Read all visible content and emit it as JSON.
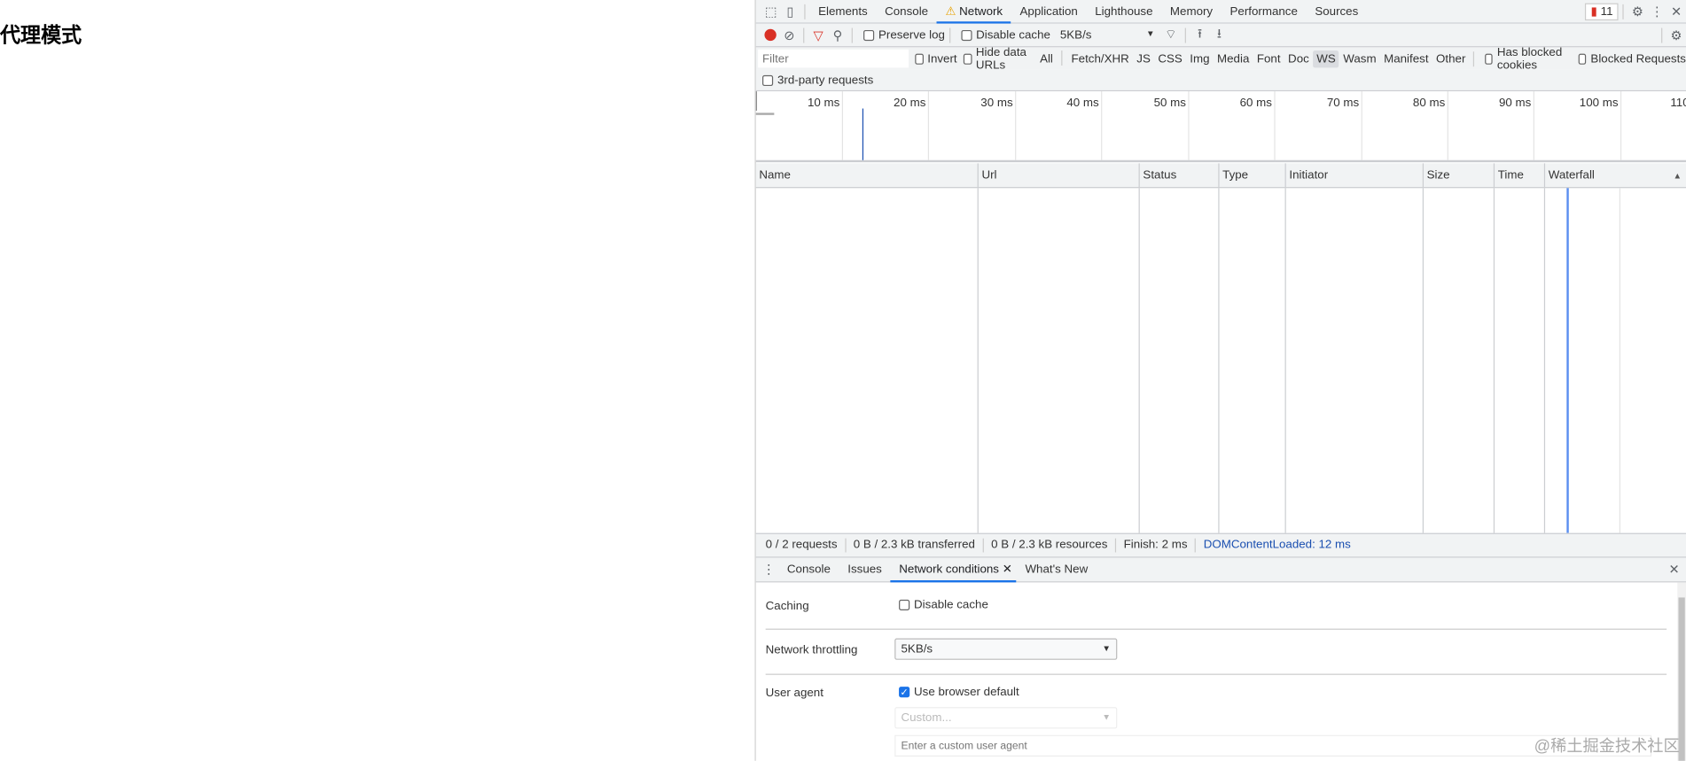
{
  "page": {
    "title": "代理模式"
  },
  "devtools": {
    "tabs": [
      "Elements",
      "Console",
      "Network",
      "Application",
      "Lighthouse",
      "Memory",
      "Performance",
      "Sources"
    ],
    "active_tab": "Network",
    "issues_count": "11",
    "toolbar": {
      "preserve_log": "Preserve log",
      "disable_cache": "Disable cache",
      "throttle": "5KB/s"
    },
    "filter": {
      "placeholder": "Filter",
      "invert": "Invert",
      "hide_data_urls": "Hide data URLs",
      "types": [
        "All",
        "Fetch/XHR",
        "JS",
        "CSS",
        "Img",
        "Media",
        "Font",
        "Doc",
        "WS",
        "Wasm",
        "Manifest",
        "Other"
      ],
      "selected_type": "WS",
      "has_blocked_cookies": "Has blocked cookies",
      "blocked_requests": "Blocked Requests",
      "third_party": "3rd-party requests"
    },
    "timeline": {
      "ticks": [
        "10 ms",
        "20 ms",
        "30 ms",
        "40 ms",
        "50 ms",
        "60 ms",
        "70 ms",
        "80 ms",
        "90 ms",
        "100 ms",
        "110"
      ],
      "dom_content_loaded_ms": 12
    },
    "columns": [
      "Name",
      "Url",
      "Status",
      "Type",
      "Initiator",
      "Size",
      "Time",
      "Waterfall"
    ],
    "status_bar": [
      "0 / 2 requests",
      "0 B / 2.3 kB transferred",
      "0 B / 2.3 kB resources",
      "Finish: 2 ms",
      "DOMContentLoaded: 12 ms"
    ],
    "drawer": {
      "tabs": [
        "Console",
        "Issues",
        "Network conditions",
        "What's New"
      ],
      "active_tab": "Network conditions",
      "caching_label": "Caching",
      "disable_cache": "Disable cache",
      "throttling_label": "Network throttling",
      "throttling_value": "5KB/s",
      "ua_label": "User agent",
      "use_browser_default": "Use browser default",
      "ua_select_placeholder": "Custom...",
      "ua_input_placeholder": "Enter a custom user agent"
    }
  },
  "watermark": "@稀土掘金技术社区",
  "colors": {
    "accent": "#1a73e8",
    "record": "#d93025",
    "dcl": "#1a4fb0"
  }
}
